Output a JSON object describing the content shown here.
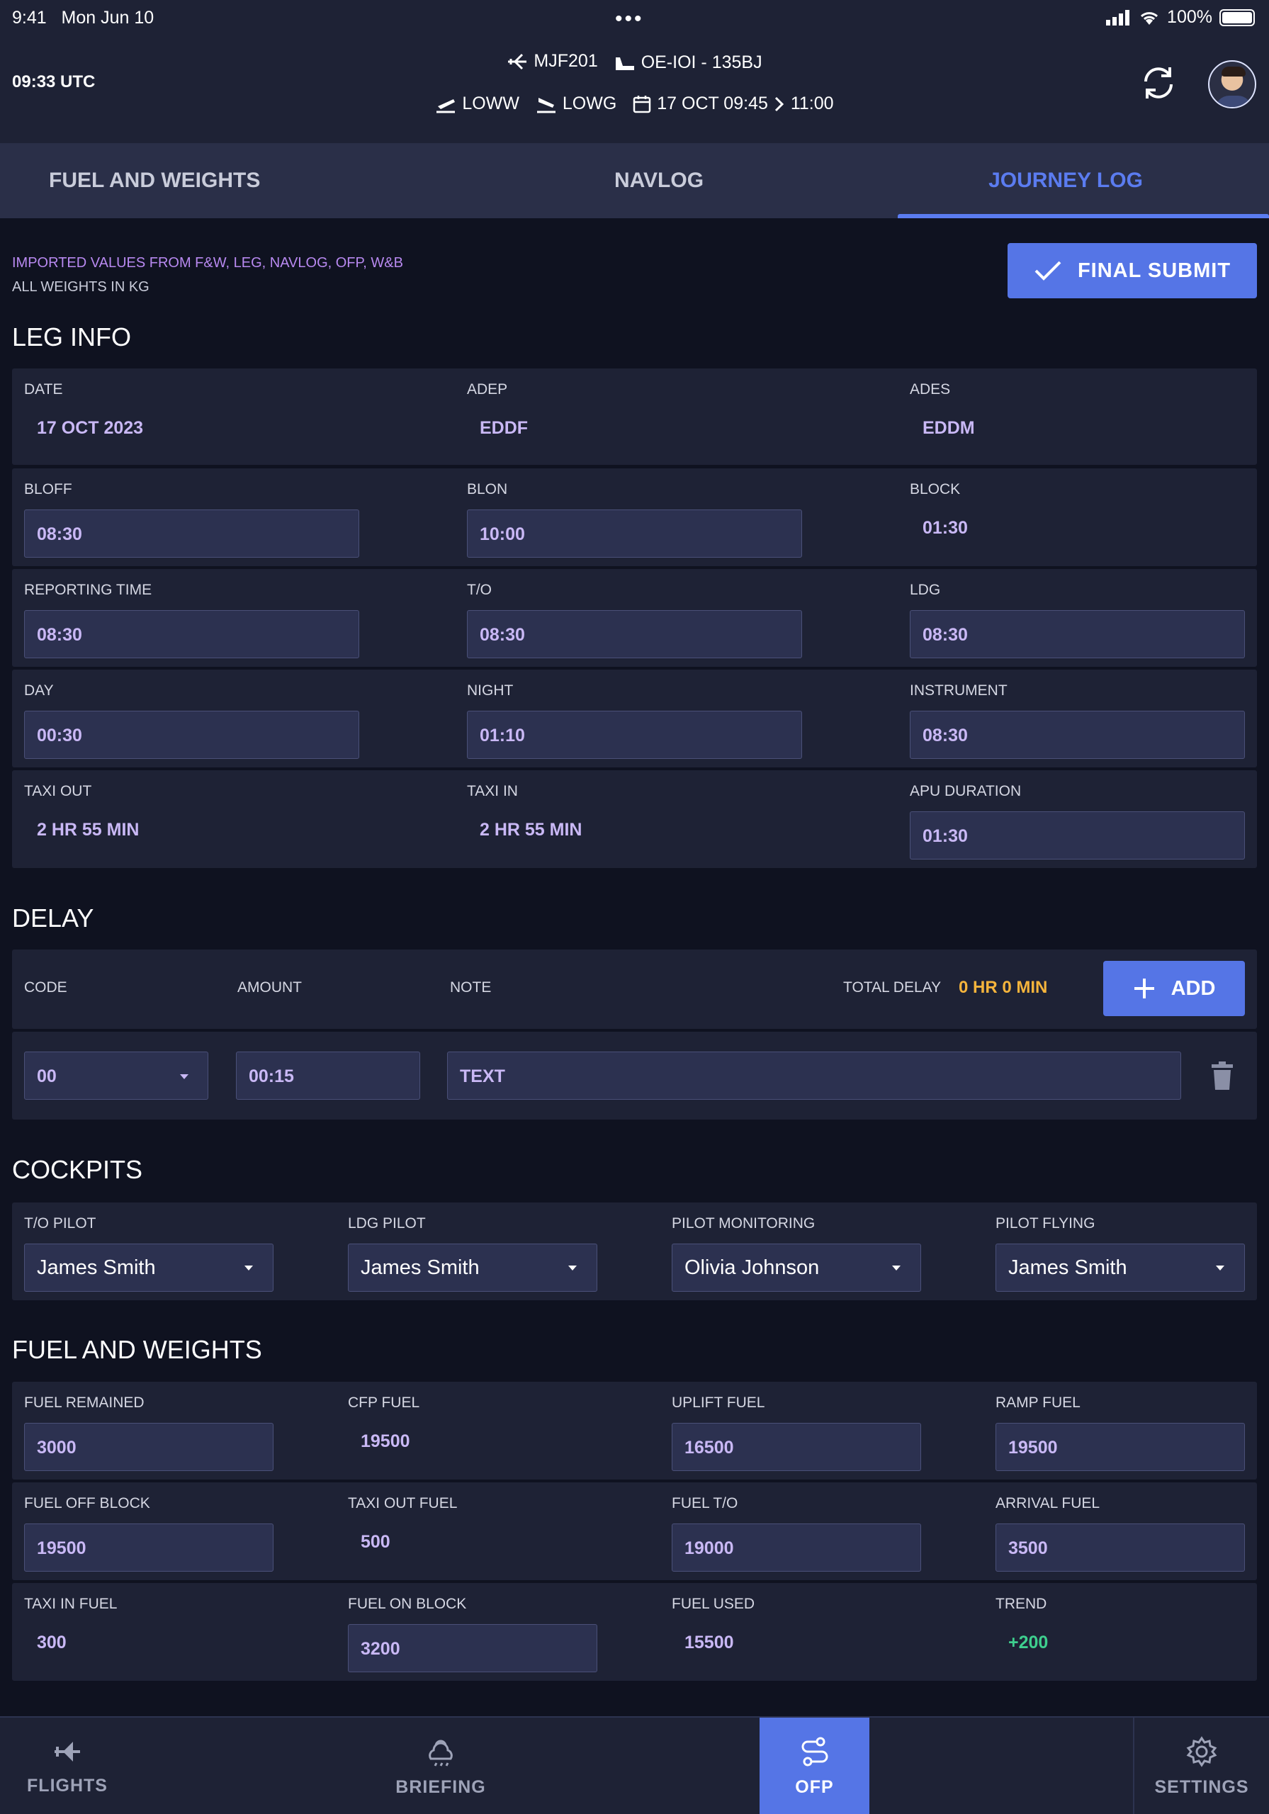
{
  "status": {
    "time": "9:41",
    "date": "Mon Jun 10",
    "battery": "100%"
  },
  "header": {
    "utc": "09:33 UTC",
    "flight": "MJF201",
    "aircraft": "OE-IOI - 135BJ",
    "dep": "LOWW",
    "arr": "LOWG",
    "date": "17 OCT 09:45",
    "arrival_time": "11:00"
  },
  "tabs": [
    "FUEL AND WEIGHTS",
    "NAVLOG",
    "JOURNEY LOG"
  ],
  "active_tab": "JOURNEY LOG",
  "notice": {
    "imported": "IMPORTED VALUES FROM F&W, LEG, NAVLOG, OFP, W&B",
    "weights": "ALL WEIGHTS IN KG"
  },
  "final_submit": "FINAL SUBMIT",
  "leg_info": {
    "title": "LEG INFO",
    "date_label": "DATE",
    "date": "17 OCT 2023",
    "adep_label": "ADEP",
    "adep": "EDDF",
    "ades_label": "ADES",
    "ades": "EDDM",
    "bloff_label": "BLOFF",
    "bloff": "08:30",
    "blon_label": "BLON",
    "blon": "10:00",
    "block_label": "BLOCK",
    "block": "01:30",
    "reporting_label": "REPORTING TIME",
    "reporting": "08:30",
    "to_label": "T/O",
    "to": "08:30",
    "ldg_label": "LDG",
    "ldg": "08:30",
    "day_label": "DAY",
    "day": "00:30",
    "night_label": "NIGHT",
    "night": "01:10",
    "instrument_label": "INSTRUMENT",
    "instrument": "08:30",
    "taxi_out_label": "TAXI OUT",
    "taxi_out": "2 HR 55 MIN",
    "taxi_in_label": "TAXI IN",
    "taxi_in": "2 HR 55 MIN",
    "apu_label": "APU DURATION",
    "apu": "01:30"
  },
  "delay": {
    "title": "DELAY",
    "code_label": "CODE",
    "amount_label": "AMOUNT",
    "note_label": "NOTE",
    "total_label": "TOTAL DELAY",
    "total": "0 HR 0 MIN",
    "add": "ADD",
    "row": {
      "code": "00",
      "amount": "00:15",
      "note": "TEXT"
    }
  },
  "cockpits": {
    "title": "COCKPITS",
    "to_pilot_label": "T/O PILOT",
    "to_pilot": "James Smith",
    "ldg_pilot_label": "LDG PILOT",
    "ldg_pilot": "James Smith",
    "pm_label": "PILOT MONITORING",
    "pm": "Olivia Johnson",
    "pf_label": "PILOT FLYING",
    "pf": "James Smith"
  },
  "fuel": {
    "title": "FUEL AND WEIGHTS",
    "remained_label": "FUEL REMAINED",
    "remained": "3000",
    "cfp_label": "CFP FUEL",
    "cfp": "19500",
    "uplift_label": "UPLIFT FUEL",
    "uplift": "16500",
    "ramp_label": "RAMP FUEL",
    "ramp": "19500",
    "off_block_label": "FUEL OFF BLOCK",
    "off_block": "19500",
    "taxi_out_label": "TAXI OUT FUEL",
    "taxi_out": "500",
    "fuel_to_label": "FUEL T/O",
    "fuel_to": "19000",
    "arrival_label": "ARRIVAL FUEL",
    "arrival": "3500",
    "taxi_in_label": "TAXI IN FUEL",
    "taxi_in": "300",
    "on_block_label": "FUEL ON BLOCK",
    "on_block": "3200",
    "used_label": "FUEL USED",
    "used": "15500",
    "trend_label": "TREND",
    "trend": "+200"
  },
  "bottom_nav": {
    "flights": "FLIGHTS",
    "briefing": "BRIEFING",
    "ofp": "OFP",
    "settings": "SETTINGS"
  },
  "colors": {
    "accent": "#5575e6",
    "value": "#c9b8f5",
    "warning": "#f5b43c",
    "positive": "#3ecf8e"
  }
}
